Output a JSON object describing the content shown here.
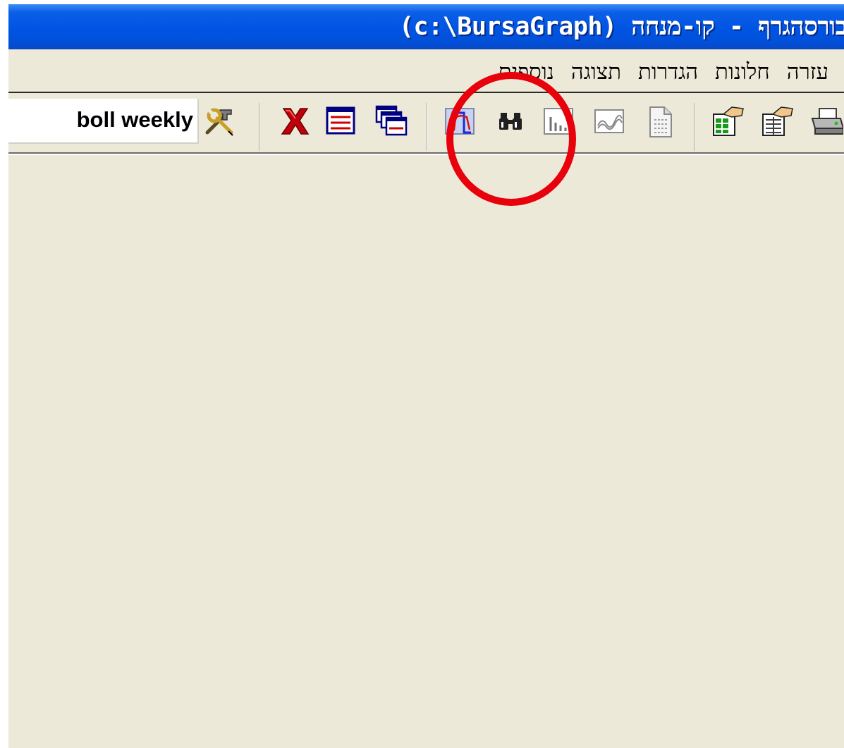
{
  "window": {
    "title": "בורסהגרף - קו-מנחה (c:\\BursaGraph)"
  },
  "menu": {
    "items": [
      {
        "id": "extras",
        "label": "נוספים"
      },
      {
        "id": "view",
        "label": "תצוגה"
      },
      {
        "id": "settings",
        "label": "הגדרות"
      },
      {
        "id": "windows",
        "label": "חלונות"
      },
      {
        "id": "help",
        "label": "עזרה"
      }
    ]
  },
  "toolbar": {
    "chart_name": "boll weekly",
    "buttons": [
      {
        "id": "tools",
        "icon": "tools-icon"
      },
      {
        "id": "delete",
        "icon": "red-x-icon"
      },
      {
        "id": "single-window",
        "icon": "window-lines-icon"
      },
      {
        "id": "cascade-windows",
        "icon": "cascade-windows-icon"
      },
      {
        "id": "line-chart",
        "icon": "line-chart-icon"
      },
      {
        "id": "find",
        "icon": "binoculars-icon"
      },
      {
        "id": "bar-chart",
        "icon": "bar-chart-icon"
      },
      {
        "id": "wave-chart",
        "icon": "wave-chart-icon"
      },
      {
        "id": "document",
        "icon": "document-icon"
      },
      {
        "id": "sheet-edit-1",
        "icon": "spreadsheet-hand-icon"
      },
      {
        "id": "sheet-edit-2",
        "icon": "sheet-hand-icon"
      },
      {
        "id": "print",
        "icon": "printer-icon"
      }
    ]
  },
  "colors": {
    "title_bar": "#0054e3",
    "window_bg": "#ece9d8",
    "annotation": "#e8000b"
  }
}
